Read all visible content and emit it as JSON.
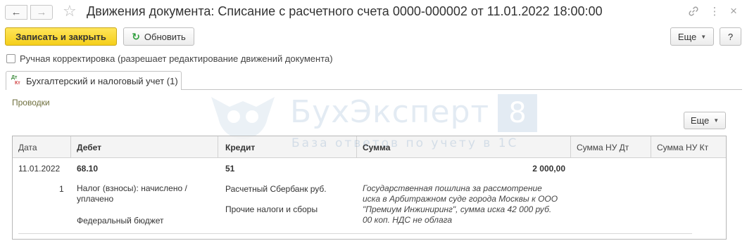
{
  "window": {
    "title": "Движения документа: Списание с расчетного счета 0000-000002 от 11.01.2022 18:00:00",
    "back_icon": "arrow-left-icon",
    "forward_icon": "arrow-right-icon",
    "favorite_icon": "star-icon",
    "link_icon": "link-icon",
    "menu_icon": "more-vertical-icon",
    "close_icon": "close-icon"
  },
  "toolbar": {
    "save_close_label": "Записать и закрыть",
    "refresh_label": "Обновить",
    "more_label": "Еще",
    "help_label": "?"
  },
  "manual_edit": {
    "label": "Ручная корректировка (разрешает редактирование движений документа)",
    "checked": false
  },
  "tabs": [
    {
      "label": "Бухгалтерский и налоговый учет (1)",
      "icon": "dt-kt-icon",
      "active": true
    }
  ],
  "section": {
    "label": "Проводки",
    "more_label": "Еще"
  },
  "watermark": {
    "title": "БухЭксперт",
    "number": "8",
    "subtitle": "База ответов по учету в 1С"
  },
  "table": {
    "columns": [
      "Дата",
      "Дебет",
      "Кредит",
      "Сумма",
      "Сумма НУ Дт",
      "Сумма НУ Кт"
    ],
    "rows": [
      {
        "date": "11.01.2022",
        "line_number": "1",
        "debit_account": "68.10",
        "debit_subconto_1": "Налог (взносы): начислено / уплачено",
        "debit_subconto_2": "Федеральный бюджет",
        "credit_account": "51",
        "credit_subconto_1": "Расчетный Сбербанк руб.",
        "credit_subconto_2": "Прочие налоги и сборы",
        "amount": "2 000,00",
        "content": "Государственная пошлина за рассмотрение иска в Арбитражном суде города Москвы к ООО \"Премиум Инжиниринг\", сумма иска 42 000 руб. 00 коп. НДС не облага",
        "amount_nu_dt": "",
        "amount_nu_kt": ""
      }
    ]
  },
  "colors": {
    "primary_button": "#f5cf1a",
    "section_label": "#6e6e3c",
    "refresh_icon": "#2e9e3c",
    "watermark": "#2e6aa8"
  }
}
